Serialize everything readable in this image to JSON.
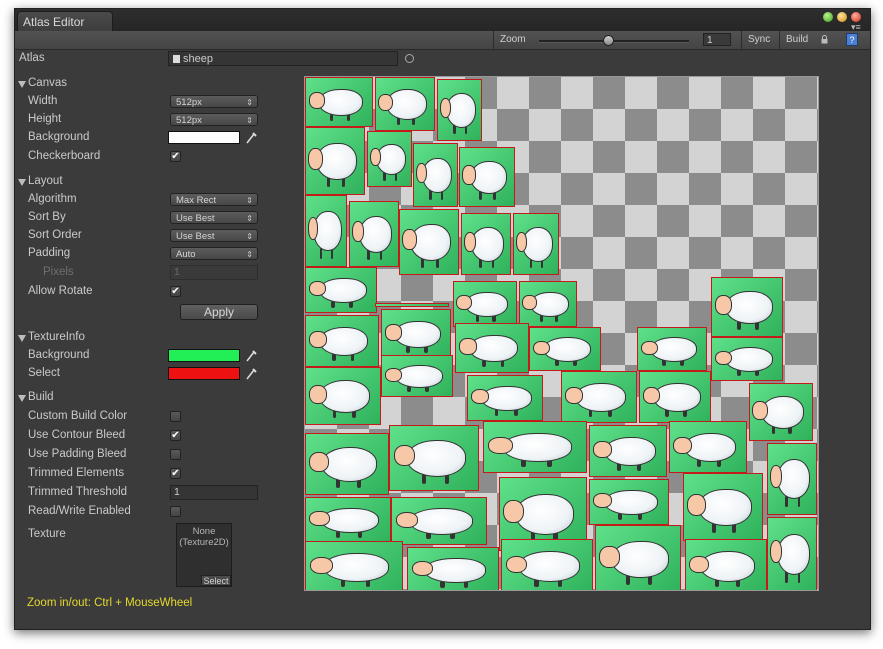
{
  "window": {
    "tab_title": "Atlas Editor"
  },
  "toolbar": {
    "zoom_label": "Zoom",
    "zoom_value": "1",
    "zoom_slider": 0.45,
    "sync_label": "Sync",
    "build_label": "Build",
    "help_glyph": "?"
  },
  "atlas": {
    "label": "Atlas",
    "asset_name": "sheep"
  },
  "canvas_section": {
    "header": "Canvas",
    "width_label": "Width",
    "width_value": "512px",
    "height_label": "Height",
    "height_value": "512px",
    "background_label": "Background",
    "background_color": "#ffffff",
    "checkerboard_label": "Checkerboard",
    "checkerboard_checked": true
  },
  "layout_section": {
    "header": "Layout",
    "algorithm_label": "Algorithm",
    "algorithm_value": "Max Rect",
    "sort_by_label": "Sort By",
    "sort_by_value": "Use Best",
    "sort_order_label": "Sort Order",
    "sort_order_value": "Use Best",
    "padding_label": "Padding",
    "padding_value": "Auto",
    "pixels_label": "Pixels",
    "pixels_value": "1",
    "allow_rotate_label": "Allow Rotate",
    "allow_rotate_checked": true,
    "apply_label": "Apply"
  },
  "textureinfo_section": {
    "header": "TextureInfo",
    "background_label": "Background",
    "background_color": "#22ee55",
    "select_label": "Select",
    "select_color": "#ee1111"
  },
  "build_section": {
    "header": "Build",
    "custom_build_color_label": "Custom Build Color",
    "custom_build_color_checked": false,
    "use_contour_bleed_label": "Use Contour Bleed",
    "use_contour_bleed_checked": true,
    "use_padding_bleed_label": "Use Padding Bleed",
    "use_padding_bleed_checked": false,
    "trimmed_elements_label": "Trimmed Elements",
    "trimmed_elements_checked": true,
    "trimmed_threshold_label": "Trimmed Threshold",
    "trimmed_threshold_value": "1",
    "read_write_label": "Read/Write Enabled",
    "read_write_checked": false,
    "texture_label": "Texture",
    "texture_none": "None",
    "texture_type": "(Texture2D)",
    "texture_select": "Select"
  },
  "hint": "Zoom in/out: Ctrl + MouseWheel",
  "colors": {
    "sprite_bg": "#3fcf6e",
    "sprite_border": "#c41a1a",
    "hint": "#e5d92c"
  },
  "atlas_sprite_count": 47
}
